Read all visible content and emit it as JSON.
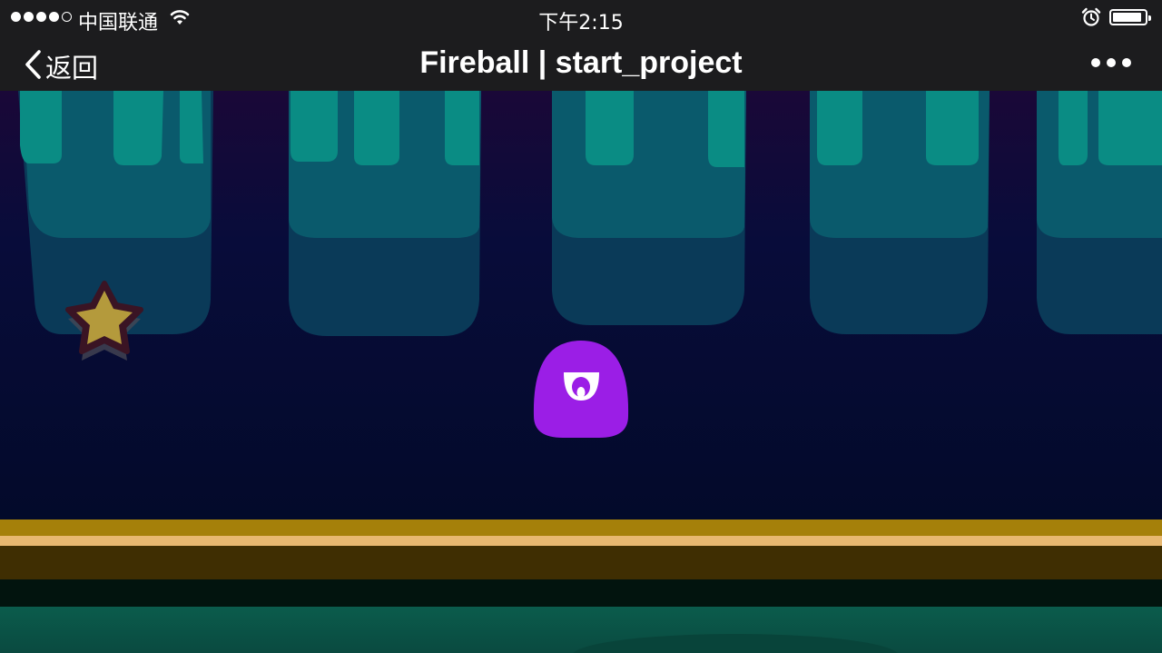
{
  "status_bar": {
    "carrier": "中国联通",
    "time": "下午2:15",
    "signal_bars_filled": 4,
    "signal_bars_total": 5,
    "battery_level": 0.9
  },
  "nav": {
    "back_label": "返回",
    "title": "Fireball | start_project"
  },
  "icons": [
    "chevron-left-icon",
    "wifi-icon",
    "alarm-icon",
    "battery-icon",
    "more-icon",
    "star-icon"
  ],
  "colors": {
    "bar_bg": "#1c1c1e",
    "sky_top": "#1a0838",
    "sky_bottom": "#030a2a",
    "stalactite_light": "#0a8c84",
    "stalactite_mid": "#0a5a6c",
    "stalactite_dark": "#0a3a58",
    "player": "#9b1ee6",
    "star": "#b49a3c",
    "ground_gold": "#a5800a",
    "ground_stripe": "#e8b870",
    "ground_dark": "#3f2e02",
    "ground_teal": "#0b5447"
  }
}
